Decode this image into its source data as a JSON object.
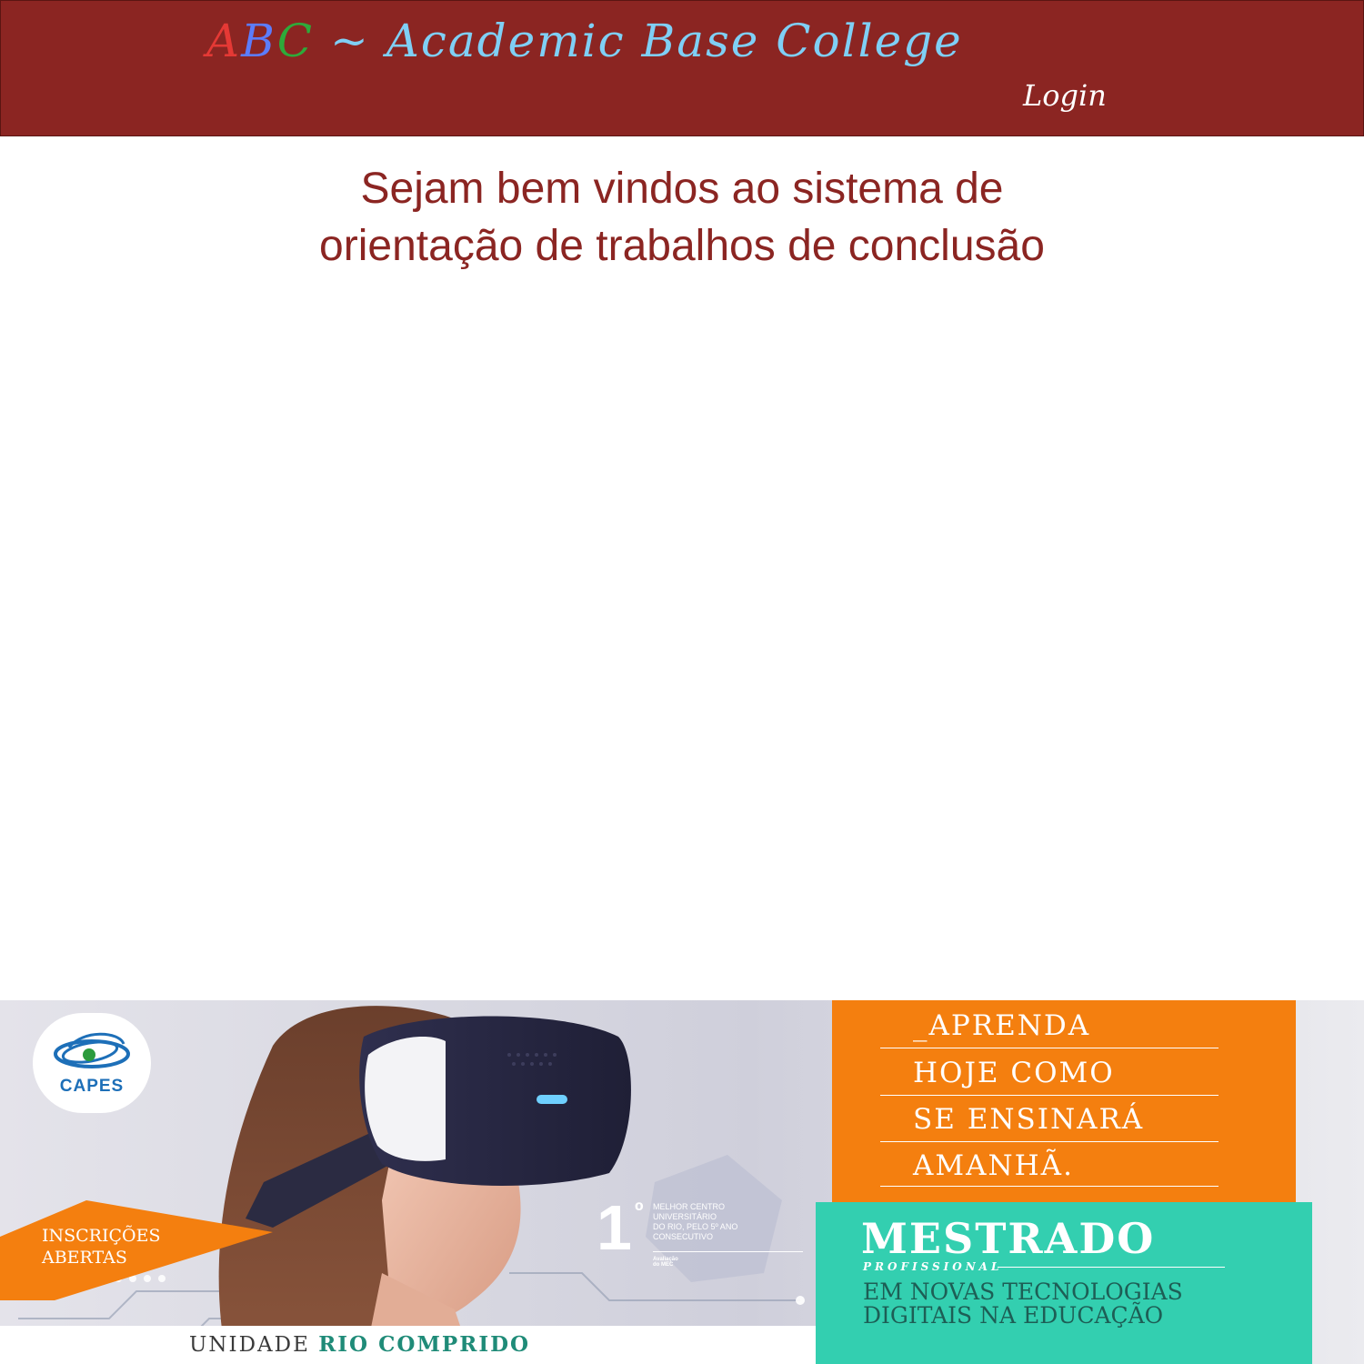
{
  "header": {
    "brand_a": "A",
    "brand_b": "B",
    "brand_c": "C",
    "brand_rest": " ~ Academic Base College",
    "login_label": "Login"
  },
  "main": {
    "welcome_line1": "Sejam bem vindos ao sistema de",
    "welcome_line2": "orientação de trabalhos de conclusão"
  },
  "banner": {
    "logo_text": "CAPES",
    "badge_line1": "INSCRIÇÕES",
    "badge_line2": "ABERTAS",
    "rank_number": "1",
    "rank_degree": "º",
    "rank_desc_1": "MELHOR CENTRO",
    "rank_desc_2": "UNIVERSITÁRIO",
    "rank_desc_3": "DO RIO, PELO 5º ANO",
    "rank_desc_4": "CONSECUTIVO",
    "rank_source": "Avaliação do MEC",
    "tagline": [
      "_APRENDA",
      "HOJE COMO",
      "SE ENSINARÁ",
      "AMANHÃ."
    ],
    "program_title": "MESTRADO",
    "program_sub": "PROFISSIONAL",
    "program_line1": "EM NOVAS TECNOLOGIAS",
    "program_line2": "DIGITAIS NA EDUCAÇÃO",
    "unit_prefix": "UNIDADE ",
    "unit_name": "RIO COMPRIDO"
  },
  "colors": {
    "header_bg": "#8b2522",
    "brand_a": "#e53935",
    "brand_b": "#5c7cfa",
    "brand_c": "#2eaa3a",
    "brand_rest": "#7fcff5",
    "welcome_text": "#8b2522",
    "banner_orange": "#f47f0f",
    "banner_green": "#33cfb0"
  }
}
